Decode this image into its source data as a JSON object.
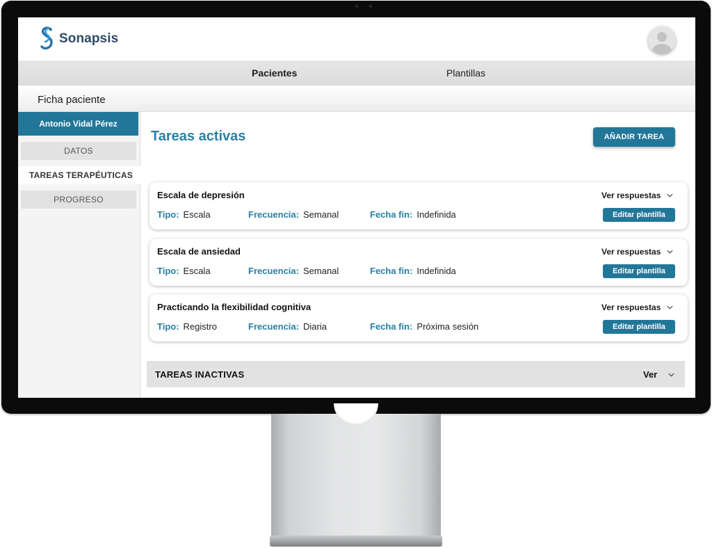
{
  "app": {
    "brand": "Sonapsis",
    "brand_color": "#2f4a66",
    "accent_color": "#227799"
  },
  "nav": {
    "items": [
      {
        "label": "Pacientes",
        "active": true
      },
      {
        "label": "Plantillas",
        "active": false
      }
    ]
  },
  "subheader": {
    "title": "Ficha paciente"
  },
  "sidebar": {
    "patient_name": "Antonio Vidal Pérez",
    "items": [
      {
        "label": "DATOS",
        "active": false
      },
      {
        "label": "TAREAS TERAPÉUTICAS",
        "active": true
      },
      {
        "label": "PROGRESO",
        "active": false
      }
    ]
  },
  "main": {
    "title": "Tareas activas",
    "add_button": "AÑADIR TAREA",
    "labels": {
      "tipo": "Tipo:",
      "frecuencia": "Frecuencia:",
      "fecha_fin": "Fecha fin:",
      "ver_respuestas": "Ver respuestas",
      "editar": "Editar plantilla"
    },
    "tasks": [
      {
        "title": "Escala de depresión",
        "tipo": "Escala",
        "frecuencia": "Semanal",
        "fecha_fin": "Indefinida"
      },
      {
        "title": "Escala de ansiedad",
        "tipo": "Escala",
        "frecuencia": "Semanal",
        "fecha_fin": "Indefinida"
      },
      {
        "title": "Practicando la flexibilidad cognitiva",
        "tipo": "Registro",
        "frecuencia": "Diaria",
        "fecha_fin": "Próxima sesión"
      }
    ],
    "inactive": {
      "title": "TAREAS INACTIVAS",
      "ver": "Ver"
    }
  },
  "icons": {
    "logo": "sonapsis-s-logo-icon",
    "avatar": "user-avatar-icon",
    "expand": "chevron-down-icon"
  }
}
